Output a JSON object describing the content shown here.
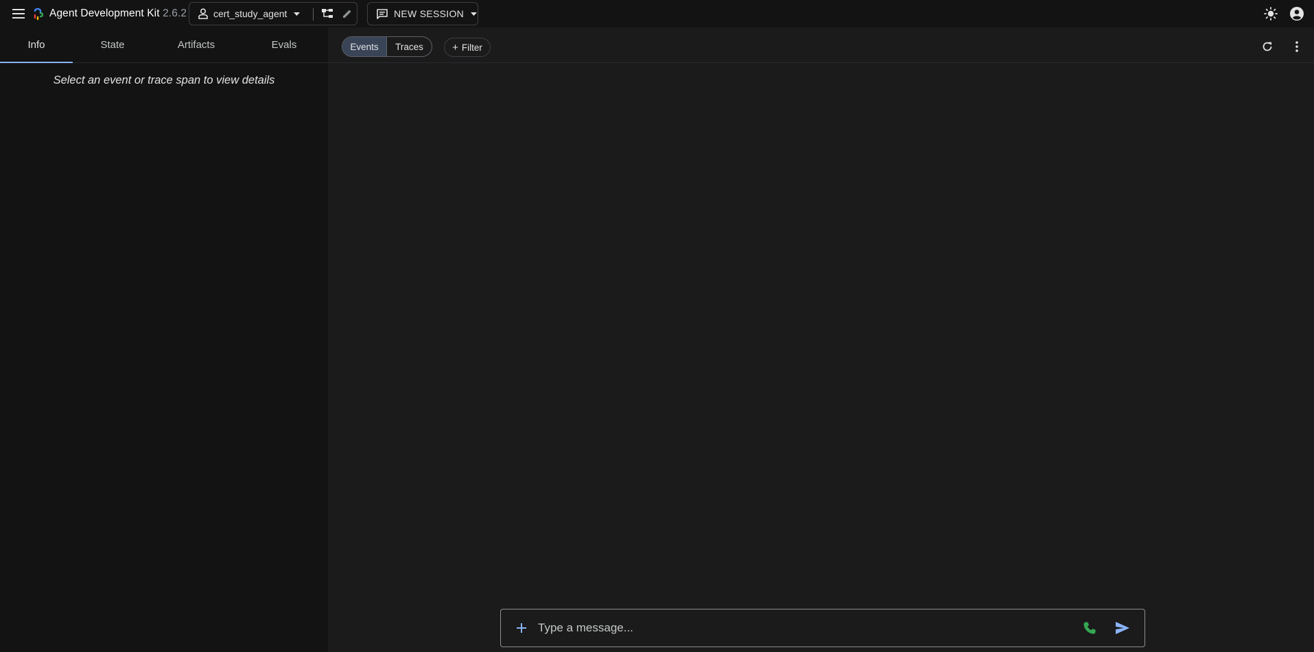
{
  "header": {
    "app_name": "Agent Development Kit",
    "version": "2.6.2",
    "agent": "cert_study_agent",
    "session_label": "NEW SESSION"
  },
  "sidebar": {
    "tabs": [
      {
        "label": "Info",
        "active": true
      },
      {
        "label": "State",
        "active": false
      },
      {
        "label": "Artifacts",
        "active": false
      },
      {
        "label": "Evals",
        "active": false
      }
    ],
    "empty_message": "Select an event or trace span to view details"
  },
  "main": {
    "view_toggle": {
      "events": "Events",
      "traces": "Traces",
      "selected": "Events"
    },
    "filter_label": "Filter"
  },
  "composer": {
    "placeholder": "Type a message..."
  },
  "colors": {
    "accent": "#8ab4f8",
    "call": "#34a853",
    "selected_segment": "#394457"
  }
}
